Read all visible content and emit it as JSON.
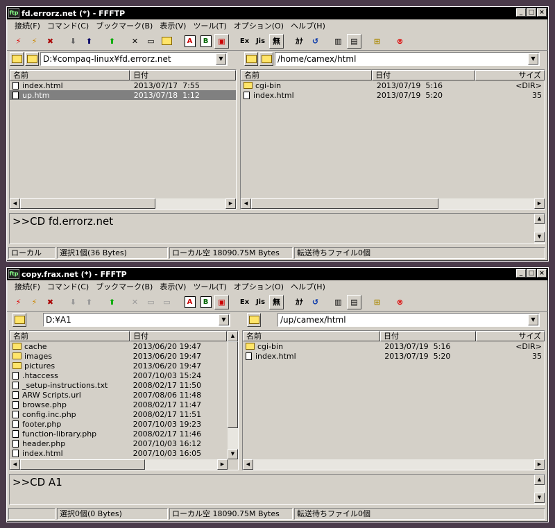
{
  "windows": [
    {
      "title": "fd.errorz.net (*) - FFFTP",
      "menu": [
        "接続(F)",
        "コマンド(C)",
        "ブックマーク(B)",
        "表示(V)",
        "ツール(T)",
        "オプション(O)",
        "ヘルプ(H)"
      ],
      "local_path": "D:¥compaq-linux¥fd.errorz.net",
      "remote_path": "/home/camex/html",
      "local_headers": {
        "name": "名前",
        "date": "日付"
      },
      "remote_headers": {
        "name": "名前",
        "date": "日付",
        "size": "サイズ"
      },
      "local_files": [
        {
          "name": "index.html",
          "date": "2013/07/17  7:55",
          "type": "file"
        },
        {
          "name": "up.htm",
          "date": "2013/07/18  1:12",
          "type": "file",
          "selected": true
        }
      ],
      "remote_files": [
        {
          "name": "cgi-bin",
          "date": "2013/07/19  5:16",
          "size": "<DIR>",
          "type": "dir"
        },
        {
          "name": "index.html",
          "date": "2013/07/19  5:20",
          "size": "35",
          "type": "file"
        }
      ],
      "log": ">>CD fd.errorz.net",
      "status": [
        "ローカル",
        "選択1個(36 Bytes)",
        "ローカル空 18090.75M Bytes",
        "転送待ちファイル0個"
      ]
    },
    {
      "title": "copy.frax.net (*) - FFFTP",
      "menu": [
        "接続(F)",
        "コマンド(C)",
        "ブックマーク(B)",
        "表示(V)",
        "ツール(T)",
        "オプション(O)",
        "ヘルプ(H)"
      ],
      "local_path": "D:¥A1",
      "remote_path": "/up/camex/html",
      "local_headers": {
        "name": "名前",
        "date": "日付"
      },
      "remote_headers": {
        "name": "名前",
        "date": "日付",
        "size": "サイズ"
      },
      "local_files": [
        {
          "name": "cache",
          "date": "2013/06/20 19:47",
          "type": "dir"
        },
        {
          "name": "images",
          "date": "2013/06/20 19:47",
          "type": "dir"
        },
        {
          "name": "pictures",
          "date": "2013/06/20 19:47",
          "type": "dir"
        },
        {
          "name": ".htaccess",
          "date": "2007/10/03 15:24",
          "type": "file"
        },
        {
          "name": "_setup-instructions.txt",
          "date": "2008/02/17 11:50",
          "type": "file"
        },
        {
          "name": "ARW Scripts.url",
          "date": "2007/08/06 11:48",
          "type": "file"
        },
        {
          "name": "browse.php",
          "date": "2008/02/17 11:47",
          "type": "file"
        },
        {
          "name": "config.inc.php",
          "date": "2008/02/17 11:51",
          "type": "file"
        },
        {
          "name": "footer.php",
          "date": "2007/10/03 19:23",
          "type": "file"
        },
        {
          "name": "function-library.php",
          "date": "2008/02/17 11:46",
          "type": "file"
        },
        {
          "name": "header.php",
          "date": "2007/10/03 16:12",
          "type": "file"
        },
        {
          "name": "index.html",
          "date": "2007/10/03 16:05",
          "type": "file"
        }
      ],
      "remote_files": [
        {
          "name": "cgi-bin",
          "date": "2013/07/19  5:16",
          "size": "<DIR>",
          "type": "dir"
        },
        {
          "name": "index.html",
          "date": "2013/07/19  5:20",
          "size": "35",
          "type": "file"
        }
      ],
      "log": ">>CD A1",
      "status": [
        "",
        "選択0個(0 Bytes)",
        "ローカル空 18090.75M Bytes",
        "転送待ちファイル0個"
      ]
    }
  ],
  "toolbar_labels": {
    "ascii": "A",
    "binary": "B",
    "kana": "ｶﾅ",
    "muhenkan": "無",
    "exc": "Ex",
    "jis": "Jis"
  }
}
